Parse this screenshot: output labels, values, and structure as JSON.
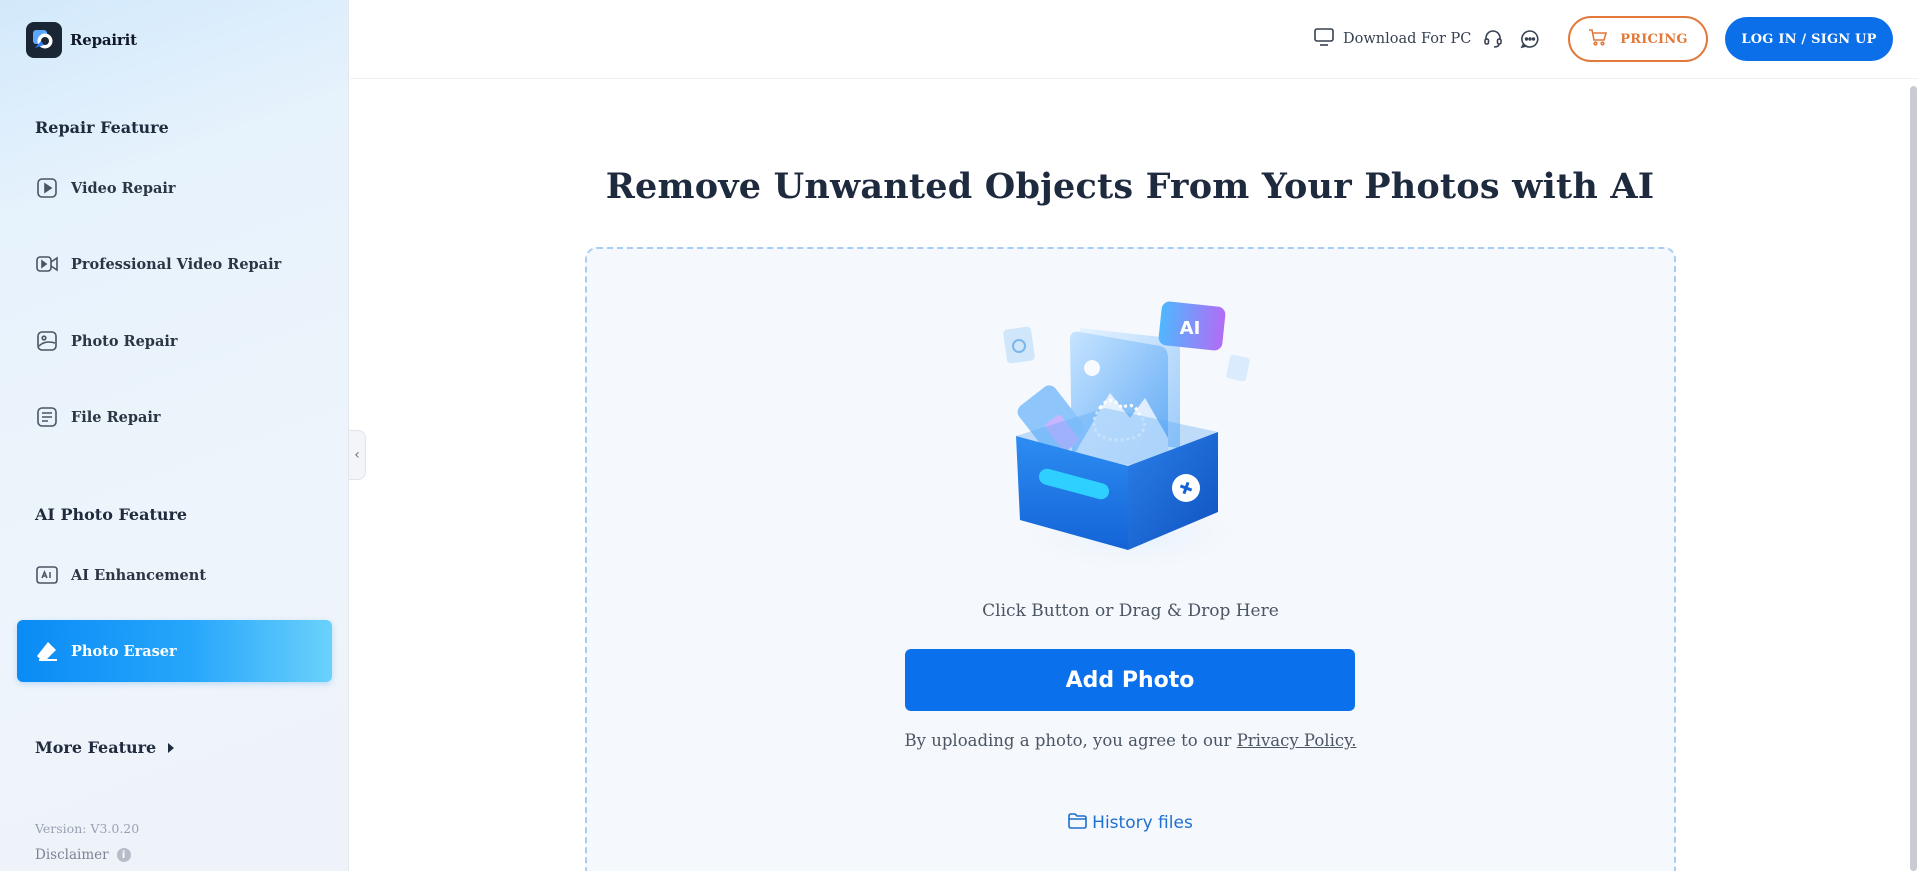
{
  "brand": {
    "name": "Repairit"
  },
  "sidebar": {
    "repair_section_title": "Repair Feature",
    "repair_items": [
      {
        "label": "Video Repair",
        "icon": "play-square-icon"
      },
      {
        "label": "Professional Video Repair",
        "icon": "video-camera-icon"
      },
      {
        "label": "Photo Repair",
        "icon": "image-icon"
      },
      {
        "label": "File Repair",
        "icon": "document-icon"
      }
    ],
    "ai_section_title": "AI Photo Feature",
    "ai_items": [
      {
        "label": "AI Enhancement",
        "icon": "ai-chip-icon",
        "active": false
      },
      {
        "label": "Photo Eraser",
        "icon": "eraser-icon",
        "active": true
      }
    ],
    "more_feature_label": "More Feature",
    "version": "Version: V3.0.20",
    "disclaimer": "Disclaimer",
    "collapse_icon": "chevron-left-icon"
  },
  "header": {
    "download_label": "Download For PC",
    "pricing_label": "PRICING",
    "login_label": "LOG IN / SIGN UP",
    "icons": [
      "monitor-icon",
      "headset-icon",
      "chat-icon",
      "cart-icon"
    ]
  },
  "main": {
    "title": "Remove Unwanted Objects From Your Photos with AI",
    "hint": "Click Button or Drag & Drop Here",
    "illustration_badge": "AI",
    "add_button": "Add Photo",
    "agree_prefix": "By uploading a photo, you agree to our",
    "privacy_link": "Privacy Policy.",
    "history_label": "History files"
  },
  "colors": {
    "accent_blue": "#0a70ec",
    "pricing_orange": "#e2793b",
    "title_dark": "#1e2a3e",
    "dropzone_border": "#a9cdf2"
  }
}
